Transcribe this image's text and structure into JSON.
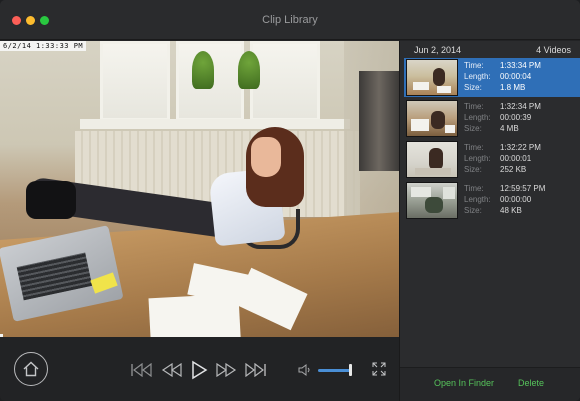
{
  "window": {
    "title": "Clip Library"
  },
  "video": {
    "timestamp": "6/2/14  1:33:33 PM"
  },
  "playback": {
    "volume": 0.8,
    "accent": "#4a8fd6"
  },
  "sidebar": {
    "date": "Jun 2, 2014",
    "count": "4 Videos",
    "labels": {
      "time": "Time:",
      "length": "Length:",
      "size": "Size:"
    },
    "clips": [
      {
        "time": "1:33:34 PM",
        "length": "00:00:04",
        "size": "1.8 MB",
        "selected": true
      },
      {
        "time": "1:32:34 PM",
        "length": "00:00:39",
        "size": "4 MB",
        "selected": false
      },
      {
        "time": "1:32:22 PM",
        "length": "00:00:01",
        "size": "252 KB",
        "selected": false
      },
      {
        "time": "12:59:57 PM",
        "length": "00:00:00",
        "size": "48 KB",
        "selected": false
      }
    ],
    "open_label": "Open In Finder",
    "delete_label": "Delete",
    "action_color": "#56c35b",
    "selection_color": "#2f6fb7"
  }
}
